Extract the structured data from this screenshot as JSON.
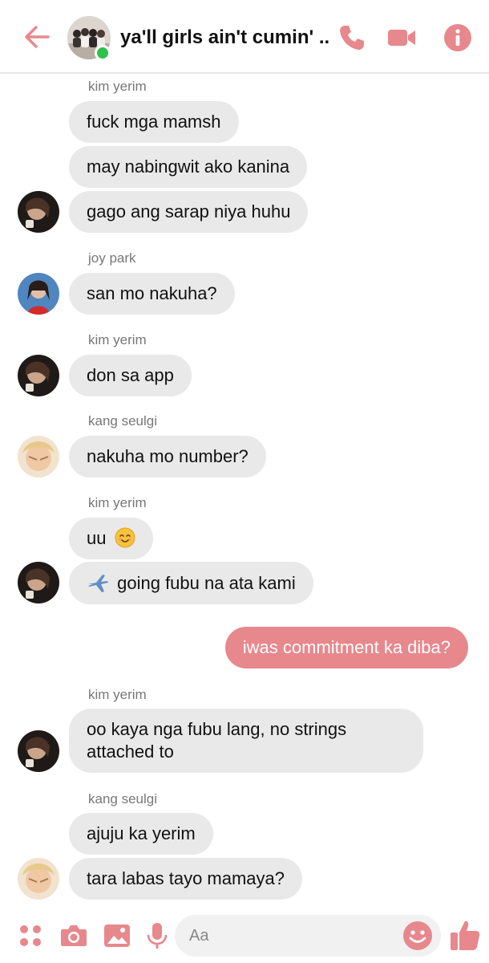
{
  "accent_color": "#e7888d",
  "header": {
    "title": "ya'll girls ain't cumin' ...",
    "icons": [
      "back-arrow-icon",
      "phone-icon",
      "video-camera-icon",
      "info-icon"
    ]
  },
  "messages": [
    {
      "type": "sender",
      "text": "kim yerim"
    },
    {
      "type": "in",
      "text": "fuck mga mamsh"
    },
    {
      "type": "in",
      "text": "may nabingwit ako kanina"
    },
    {
      "type": "in",
      "text": "gago ang sarap niya huhu"
    },
    {
      "type": "sender",
      "text": "joy park"
    },
    {
      "type": "in",
      "text": "san mo nakuha?"
    },
    {
      "type": "sender",
      "text": "kim yerim"
    },
    {
      "type": "in",
      "text": "don sa app"
    },
    {
      "type": "sender",
      "text": "kang seulgi"
    },
    {
      "type": "in",
      "text": "nakuha mo number?"
    },
    {
      "type": "sender",
      "text": "kim yerim"
    },
    {
      "type": "in",
      "text": "uu",
      "emoji": "smiling-face-icon"
    },
    {
      "type": "in",
      "text": "going fubu na ata kami",
      "emoji": "airplane-icon"
    },
    {
      "type": "out",
      "text": "iwas commitment ka diba?"
    },
    {
      "type": "sender",
      "text": "kim yerim"
    },
    {
      "type": "in",
      "text": "oo kaya nga fubu lang, no strings attached to"
    },
    {
      "type": "sender",
      "text": "kang seulgi"
    },
    {
      "type": "in",
      "text": "ajuju ka yerim"
    },
    {
      "type": "in",
      "text": "tara labas tayo mamaya?"
    }
  ],
  "composer": {
    "placeholder": "Aa",
    "icons": [
      "apps-icon",
      "camera-icon",
      "image-icon",
      "microphone-icon",
      "emoji-icon",
      "thumbs-up-icon"
    ]
  }
}
